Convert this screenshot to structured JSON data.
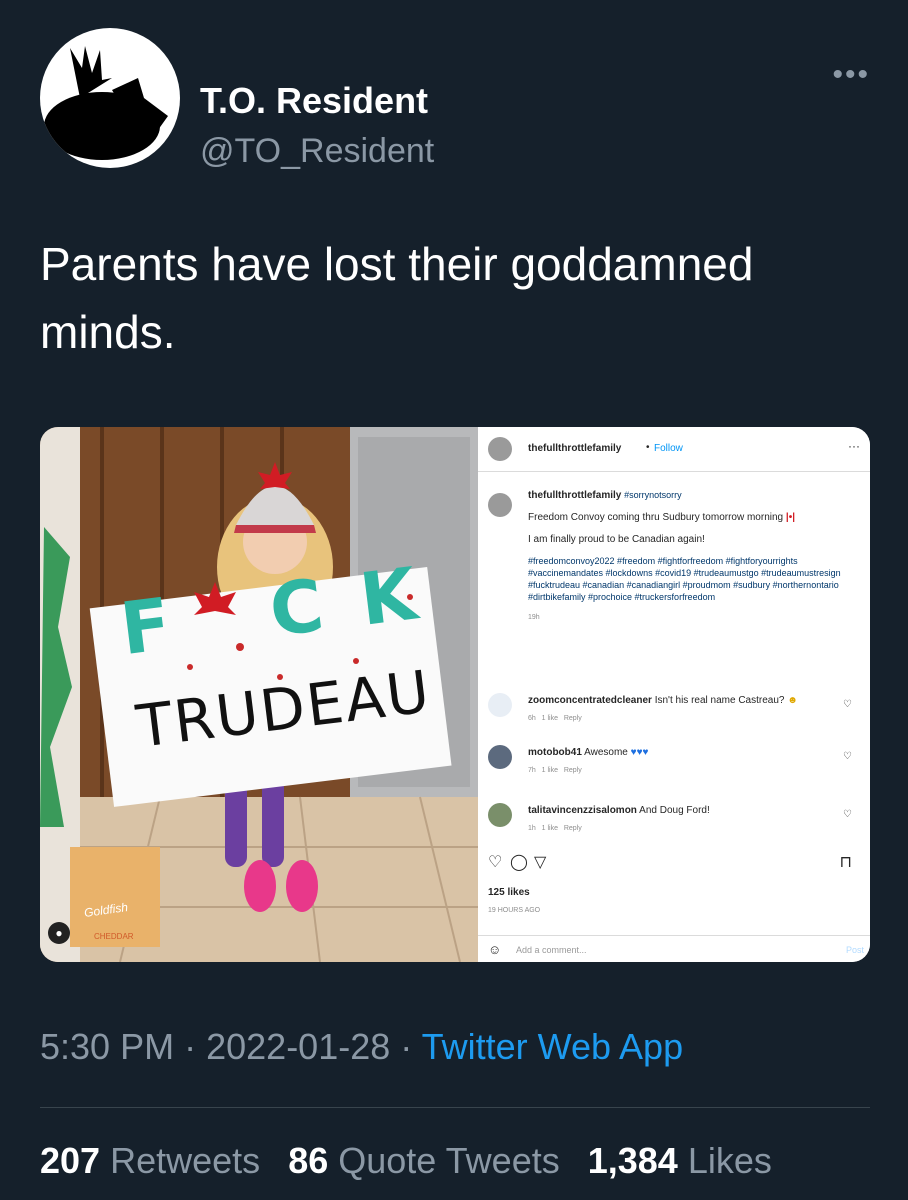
{
  "user": {
    "display_name": "T.O. Resident",
    "handle": "@TO_Resident",
    "more_icon": "more-horizontal-icon"
  },
  "tweet": {
    "text": "Parents have lost their goddamned minds."
  },
  "media": {
    "photo": {
      "sign_line1": "F CK",
      "sign_line2": "TRUDEAU",
      "box_label": "Goldfish",
      "box_sub": "CHEDDAR"
    },
    "instagram": {
      "header_user": "thefullthrottlefamily",
      "follow": "Follow",
      "dots": "···",
      "caption_user": "thefullthrottlefamily",
      "caption_tag": "#sorrynotsorry",
      "caption_line1": "Freedom Convoy coming thru Sudbury tomorrow morning",
      "caption_line2": "I am finally proud to be Canadian again!",
      "hashtags": "#freedomconvoy2022 #freedom #fightforfreedom #fightforyourrights #vaccinemandates #lockdowns #covid19 #trudeaumustgo #trudeaumustresign #fucktrudeau #canadian #canadiangirl #proudmom #sudbury #northernontario #dirtbikefamily #prochoice #truckersforfreedom",
      "caption_age": "19h",
      "comments": [
        {
          "user": "zoomconcentratedcleaner",
          "text": "Isn't his real name Castreau?",
          "age": "6h",
          "likes": "1 like",
          "reply": "Reply"
        },
        {
          "user": "motobob41",
          "text": "Awesome",
          "age": "7h",
          "likes": "1 like",
          "reply": "Reply"
        },
        {
          "user": "talitavincenzzisalomon",
          "text": "And Doug Ford!",
          "age": "1h",
          "likes": "1 like",
          "reply": "Reply"
        }
      ],
      "likes": "125 likes",
      "time": "19 HOURS AGO",
      "add_comment": "Add a comment...",
      "post": "Post"
    }
  },
  "footer": {
    "time": "5:30 PM",
    "sep": "·",
    "date": "2022-01-28",
    "source": "Twitter Web App"
  },
  "stats": {
    "retweets_count": "207",
    "retweets_label": "Retweets",
    "quotes_count": "86",
    "quotes_label": "Quote Tweets",
    "likes_count": "1,384",
    "likes_label": "Likes"
  },
  "colors": {
    "background": "#15202b",
    "secondary_text": "#8b98a5",
    "link": "#1d9bf0"
  }
}
